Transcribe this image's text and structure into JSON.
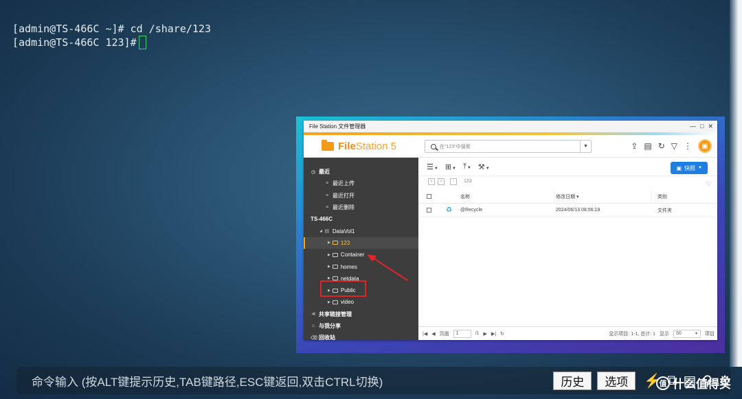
{
  "terminal": {
    "line1": "[admin@TS-466C ~]# cd /share/123",
    "line2": "[admin@TS-466C 123]#"
  },
  "filestation": {
    "window_title": "File Station 文件管理器",
    "logo_bold": "File",
    "logo_thin": "Station 5",
    "search_placeholder": "在\"123\"中搜索",
    "snapshot_label": "快照",
    "sidebar": {
      "recent": "最近",
      "recent_upload": "最近上传",
      "recent_open": "最近打开",
      "recent_delete": "最近删除",
      "nas": "TS-466C",
      "volume": "DataVol1",
      "folders": [
        "123",
        "Container",
        "homes",
        "netdata",
        "Public",
        "video"
      ],
      "shared_links": "共享链接管理",
      "shared_with_me": "与我分享",
      "recycle": "回收站"
    },
    "path": "123",
    "columns": {
      "name": "名称",
      "date": "修改日期",
      "type": "类别"
    },
    "rows": [
      {
        "name": "@Recycle",
        "date": "2024/06/13 08:56:19",
        "type": "文件夹"
      }
    ],
    "footer": {
      "page_label": "页面",
      "page": "1",
      "page_total": "/1",
      "display_info": "显示项目: 1-1, 总计: 1",
      "per_page_label": "显示",
      "per_page": "50",
      "unit": "项目"
    },
    "colors": {
      "accent": "#f4a21b",
      "highlight_box": "#e0242a",
      "snapshot_btn": "#1e7fe0"
    }
  },
  "cmdbar": {
    "hint": "命令输入 (按ALT键提示历史,TAB键路径,ESC键返回,双击CTRL切换)",
    "history": "历史",
    "options": "选项",
    "icons": [
      "lightning-icon",
      "copy-icon",
      "paste-icon",
      "search-icon",
      "settings-icon"
    ]
  },
  "watermark": "什么值得买"
}
